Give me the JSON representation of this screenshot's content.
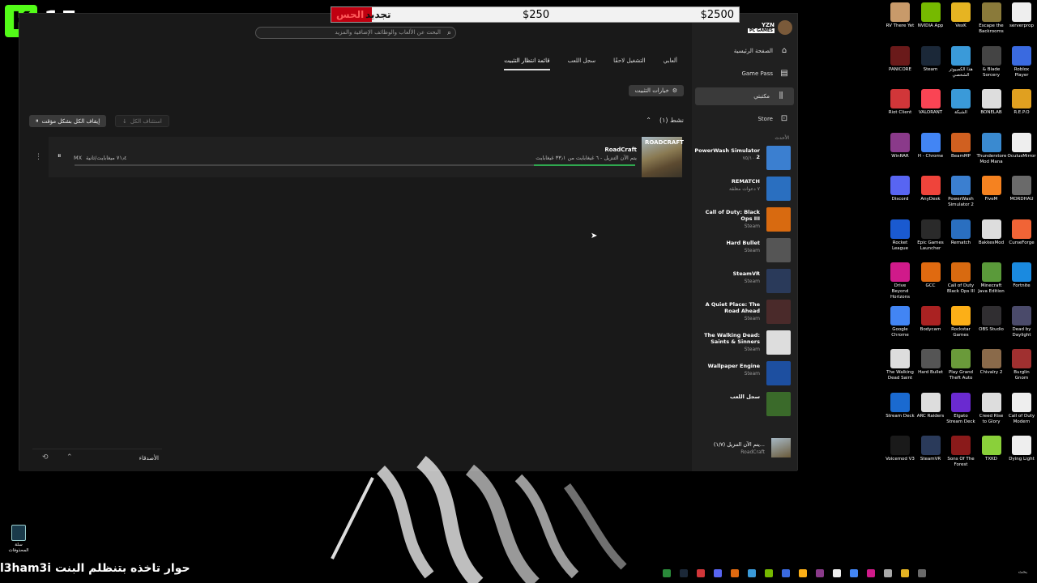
{
  "overlay": {
    "counter": "15",
    "goal_label": "تجديد",
    "goal_fill_label": "الحس",
    "goal_mid": "$250",
    "goal_max": "$2500",
    "bottom_caption": "l3ham3i حوار تاخذه بتنظلم البنت"
  },
  "xbox": {
    "search_placeholder": "البحث عن الألعاب والوظائف الإضافية والمزيد",
    "tabs": [
      {
        "label": "ألعابي",
        "active": false
      },
      {
        "label": "التشغيل لاحقًا",
        "active": false
      },
      {
        "label": "سجل اللعب",
        "active": false
      },
      {
        "label": "قائمة انتظار التثبيت",
        "active": true
      }
    ],
    "install_options_label": "خيارات التثبيت",
    "active_header": "نشط (١)",
    "resume_all_label": "استئناف الكل",
    "pause_all_label": "إيقاف الكل بشكل مؤقت",
    "download": {
      "title": "RoadCraft",
      "thumb_label": "ROADCRAFT",
      "status": "يتم الآن التنزيل - ٦ غيغابايت من ٣٣٫١ غيغابايت",
      "speed": "٧١٫٤ ميغابايت/ثانية",
      "speed_unit": "MX",
      "progress": 0.18
    },
    "friends_label": "الأصدقاء",
    "profile": {
      "name": "YZN",
      "badge": "PC GAMES"
    },
    "nav": [
      {
        "label": "الصفحة الرئيسية",
        "icon": "home-icon"
      },
      {
        "label": "Game Pass",
        "icon": "gamepass-icon"
      },
      {
        "label": "مكتبتي",
        "icon": "library-icon",
        "active": true
      },
      {
        "label": "Store",
        "icon": "store-icon"
      }
    ],
    "recent_label": "الأحدث",
    "recent_games": [
      {
        "title": "PowerWash Simulator 2",
        "sub": "٧٥/١٠٠٠",
        "color": "#3b7fd0"
      },
      {
        "title": "REMATCH",
        "sub": "٧ دعوات معلقة",
        "color": "#2a6fc0"
      },
      {
        "title": "Call of Duty: Black Ops III",
        "sub": "Steam",
        "color": "#d86a10"
      },
      {
        "title": "Hard Bullet",
        "sub": "Steam",
        "color": "#555555"
      },
      {
        "title": "SteamVR",
        "sub": "Steam",
        "color": "#2a3a5a"
      },
      {
        "title": "A Quiet Place: The Road Ahead",
        "sub": "Steam",
        "color": "#4a2a2a"
      },
      {
        "title": "The Walking Dead: Saints & Sinners",
        "sub": "Steam",
        "color": "#ddd"
      },
      {
        "title": "Wallpaper Engine",
        "sub": "Steam",
        "color": "#1d4fa0"
      },
      {
        "title": "سجل اللعب",
        "sub": "",
        "color": "#3a6a2a"
      }
    ],
    "mini_download": {
      "status": "يتم الآن التنزيل (١/٧)...",
      "name": "RoadCraft"
    }
  },
  "desktop_icons": [
    {
      "label": "RV There Yet",
      "color": "#c89a6a"
    },
    {
      "label": "NVIDIA App",
      "color": "#76b900"
    },
    {
      "label": "VexK",
      "color": "#e6b422"
    },
    {
      "label": "Escape the Backrooms",
      "color": "#8a7a3a"
    },
    {
      "label": "serverprop",
      "color": "#eeeeee"
    },
    {
      "label": "PANICORE",
      "color": "#6a1a1a"
    },
    {
      "label": "Steam",
      "color": "#1b2838"
    },
    {
      "label": "هذا الكمبيوتر الشخصي",
      "color": "#3a9ad9"
    },
    {
      "label": "& Blade Sorcery",
      "color": "#444444"
    },
    {
      "label": "Roblox Player",
      "color": "#3a6ae0"
    },
    {
      "label": "Riot Client",
      "color": "#d13639"
    },
    {
      "label": "VALORANT",
      "color": "#fa4454"
    },
    {
      "label": "الشبكة",
      "color": "#3a9ad9"
    },
    {
      "label": "BONELAB",
      "color": "#dddddd"
    },
    {
      "label": "R.E.P.O",
      "color": "#e0a020"
    },
    {
      "label": "WinRAR",
      "color": "#8a3a8a"
    },
    {
      "label": "H - Chrome",
      "color": "#4285f4"
    },
    {
      "label": "BeamMP",
      "color": "#d06020"
    },
    {
      "label": "Thunderstore Mod Mana",
      "color": "#3a8ad0"
    },
    {
      "label": "OculusMirror",
      "color": "#eeeeee"
    },
    {
      "label": "Discord",
      "color": "#5865f2"
    },
    {
      "label": "AnyDesk",
      "color": "#ef443b"
    },
    {
      "label": "PowerWash Simulator 2",
      "color": "#3b7fd0"
    },
    {
      "label": "FiveM",
      "color": "#f58220"
    },
    {
      "label": "MORDHAU",
      "color": "#6a6a6a"
    },
    {
      "label": "Rocket League",
      "color": "#1a5ad0"
    },
    {
      "label": "Epic Games Launcher",
      "color": "#2a2a2a"
    },
    {
      "label": "Rematch",
      "color": "#2a6fc0"
    },
    {
      "label": "BakkesMod",
      "color": "#dddddd"
    },
    {
      "label": "CurseForge",
      "color": "#f16436"
    },
    {
      "label": "Drive Beyond Horizons",
      "color": "#d01a8a"
    },
    {
      "label": "GCC",
      "color": "#e06a10"
    },
    {
      "label": "Call of Duty Black Ops III",
      "color": "#d86a10"
    },
    {
      "label": "Minecraft Java Edition",
      "color": "#5a9a3a"
    },
    {
      "label": "Fortnite",
      "color": "#1a8ae0"
    },
    {
      "label": "Google Chrome",
      "color": "#4285f4"
    },
    {
      "label": "Bodycam",
      "color": "#aa2222"
    },
    {
      "label": "Rockstar Games",
      "color": "#fcaf17"
    },
    {
      "label": "OBS Studio",
      "color": "#302e31"
    },
    {
      "label": "Dead by Daylight",
      "color": "#4a4a6a"
    },
    {
      "label": "The Walking Dead Saint",
      "color": "#dddddd"
    },
    {
      "label": "Hard Bullet",
      "color": "#555555"
    },
    {
      "label": "Play Grand Theft Auto",
      "color": "#6a9a3a"
    },
    {
      "label": "Chivalry 2",
      "color": "#8a6a4a"
    },
    {
      "label": "Burglin Gnom",
      "color": "#a03030"
    },
    {
      "label": "Stream Deck",
      "color": "#1a6ad0"
    },
    {
      "label": "ARC Raiders",
      "color": "#dddddd"
    },
    {
      "label": "Elgato Stream Deck",
      "color": "#6a2ad0"
    },
    {
      "label": "Creed Rise to Glory",
      "color": "#dddddd"
    },
    {
      "label": "Call of Duty Modern",
      "color": "#eeeeee"
    },
    {
      "label": "Voicemod V3",
      "color": "#1a1a1a"
    },
    {
      "label": "SteamVR",
      "color": "#2a3a5a"
    },
    {
      "label": "Sons Of The Forest",
      "color": "#8a1a1a"
    },
    {
      "label": "TXKD",
      "color": "#8ad03a"
    },
    {
      "label": "Dying Light",
      "color": "#eeeeee"
    }
  ],
  "recycle_label": "سلة المحذوفات",
  "taskbar": {
    "search": "بحث"
  }
}
